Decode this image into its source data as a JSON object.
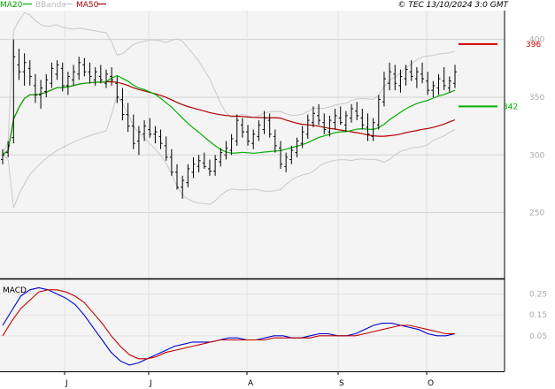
{
  "header": {
    "legend": [
      {
        "label": "MA20",
        "color": "#00a000"
      },
      {
        "label": "BBands",
        "color": "#c0c0c0"
      },
      {
        "label": "MA50",
        "color": "#a00000"
      }
    ],
    "copyright": "© TEC 13/10/2024 3:0 GMT"
  },
  "colors": {
    "price": "#000000",
    "ma20": "#00b000",
    "ma50": "#b00000",
    "bbands": "#c8c8c8",
    "grid": "#d2d2d2",
    "panel_bg": "#f4f4f4",
    "macd": "#0000d0",
    "signal": "#c00000",
    "resistance": "#d00000",
    "support": "#00b000"
  },
  "chart_data": [
    {
      "type": "line",
      "title": "",
      "price_axis": {
        "ylim": [
          193,
          425
        ],
        "ticks": [
          250,
          300,
          350,
          400
        ],
        "grid": true
      },
      "months": [
        "J",
        "J",
        "A",
        "S",
        "O"
      ],
      "levels": {
        "resistance": {
          "value": 396,
          "label": "396"
        },
        "support": {
          "value": 342,
          "label": "342"
        }
      },
      "bars": [
        [
          296,
          305,
          292,
          300
        ],
        [
          302,
          312,
          298,
          308
        ],
        [
          315,
          400,
          310,
          385
        ],
        [
          378,
          392,
          365,
          372
        ],
        [
          372,
          388,
          360,
          380
        ],
        [
          375,
          382,
          360,
          368
        ],
        [
          360,
          370,
          345,
          352
        ],
        [
          352,
          365,
          340,
          358
        ],
        [
          355,
          370,
          350,
          365
        ],
        [
          362,
          380,
          358,
          375
        ],
        [
          370,
          382,
          365,
          378
        ],
        [
          375,
          380,
          355,
          360
        ],
        [
          360,
          372,
          352,
          368
        ],
        [
          365,
          378,
          360,
          372
        ],
        [
          370,
          385,
          365,
          380
        ],
        [
          378,
          384,
          368,
          372
        ],
        [
          372,
          380,
          362,
          368
        ],
        [
          365,
          376,
          360,
          372
        ],
        [
          368,
          378,
          362,
          365
        ],
        [
          362,
          374,
          358,
          370
        ],
        [
          368,
          376,
          360,
          365
        ],
        [
          362,
          368,
          345,
          350
        ],
        [
          348,
          358,
          330,
          335
        ],
        [
          335,
          345,
          320,
          325
        ],
        [
          325,
          335,
          305,
          310
        ],
        [
          312,
          325,
          300,
          320
        ],
        [
          318,
          330,
          312,
          325
        ],
        [
          322,
          332,
          315,
          318
        ],
        [
          318,
          325,
          310,
          320
        ],
        [
          316,
          322,
          305,
          310
        ],
        [
          308,
          316,
          295,
          298
        ],
        [
          298,
          305,
          282,
          285
        ],
        [
          285,
          292,
          270,
          272
        ],
        [
          272,
          282,
          262,
          278
        ],
        [
          276,
          292,
          272,
          288
        ],
        [
          285,
          298,
          280,
          292
        ],
        [
          290,
          300,
          285,
          295
        ],
        [
          293,
          302,
          288,
          290
        ],
        [
          288,
          296,
          282,
          286
        ],
        [
          286,
          300,
          282,
          296
        ],
        [
          294,
          306,
          290,
          302
        ],
        [
          300,
          312,
          296,
          306
        ],
        [
          304,
          318,
          300,
          314
        ],
        [
          312,
          335,
          308,
          330
        ],
        [
          326,
          332,
          315,
          320
        ],
        [
          320,
          326,
          308,
          312
        ],
        [
          310,
          322,
          305,
          318
        ],
        [
          316,
          330,
          312,
          326
        ],
        [
          322,
          338,
          318,
          332
        ],
        [
          330,
          336,
          315,
          318
        ],
        [
          316,
          322,
          302,
          308
        ],
        [
          306,
          312,
          288,
          292
        ],
        [
          290,
          302,
          285,
          298
        ],
        [
          296,
          308,
          292,
          304
        ],
        [
          302,
          315,
          298,
          312
        ],
        [
          310,
          325,
          306,
          320
        ],
        [
          318,
          335,
          314,
          330
        ],
        [
          328,
          342,
          324,
          336
        ],
        [
          334,
          344,
          326,
          330
        ],
        [
          328,
          336,
          318,
          322
        ],
        [
          320,
          334,
          316,
          330
        ],
        [
          328,
          340,
          322,
          334
        ],
        [
          332,
          342,
          326,
          328
        ],
        [
          326,
          338,
          320,
          334
        ],
        [
          332,
          344,
          328,
          340
        ],
        [
          338,
          346,
          330,
          334
        ],
        [
          332,
          340,
          322,
          326
        ],
        [
          324,
          336,
          312,
          318
        ],
        [
          316,
          332,
          312,
          328
        ],
        [
          326,
          352,
          322,
          348
        ],
        [
          346,
          372,
          342,
          366
        ],
        [
          362,
          380,
          356,
          372
        ],
        [
          370,
          378,
          356,
          362
        ],
        [
          360,
          374,
          354,
          368
        ],
        [
          366,
          378,
          360,
          374
        ],
        [
          372,
          382,
          364,
          368
        ],
        [
          366,
          376,
          358,
          372
        ],
        [
          370,
          380,
          362,
          366
        ],
        [
          364,
          372,
          352,
          356
        ],
        [
          356,
          364,
          350,
          360
        ],
        [
          358,
          370,
          352,
          366
        ],
        [
          364,
          376,
          356,
          360
        ],
        [
          358,
          368,
          354,
          364
        ],
        [
          362,
          378,
          358,
          372
        ]
      ]
    },
    {
      "type": "line",
      "title": "MACD",
      "ylim": [
        -0.12,
        0.32
      ],
      "ticks": [
        0.05,
        0.15,
        0.25
      ],
      "series": [
        {
          "values": [
            0.1,
            0.17,
            0.24,
            0.27,
            0.28,
            0.27,
            0.25,
            0.23,
            0.2,
            0.15,
            0.09,
            0.03,
            -0.03,
            -0.07,
            -0.09,
            -0.08,
            -0.06,
            -0.04,
            -0.02,
            0.0,
            0.01,
            0.02,
            0.02,
            0.02,
            0.03,
            0.04,
            0.04,
            0.03,
            0.03,
            0.04,
            0.05,
            0.05,
            0.04,
            0.04,
            0.05,
            0.06,
            0.06,
            0.05,
            0.05,
            0.06,
            0.08,
            0.1,
            0.11,
            0.11,
            0.1,
            0.09,
            0.08,
            0.06,
            0.05,
            0.05,
            0.06
          ]
        },
        {
          "values": [
            0.05,
            0.12,
            0.18,
            0.22,
            0.26,
            0.27,
            0.27,
            0.26,
            0.24,
            0.21,
            0.16,
            0.11,
            0.05,
            0.0,
            -0.04,
            -0.06,
            -0.06,
            -0.05,
            -0.03,
            -0.02,
            -0.01,
            0.0,
            0.01,
            0.02,
            0.03,
            0.03,
            0.03,
            0.03,
            0.03,
            0.03,
            0.04,
            0.04,
            0.04,
            0.04,
            0.04,
            0.05,
            0.05,
            0.05,
            0.05,
            0.05,
            0.06,
            0.07,
            0.08,
            0.09,
            0.1,
            0.1,
            0.09,
            0.08,
            0.07,
            0.06,
            0.06
          ]
        }
      ]
    }
  ]
}
